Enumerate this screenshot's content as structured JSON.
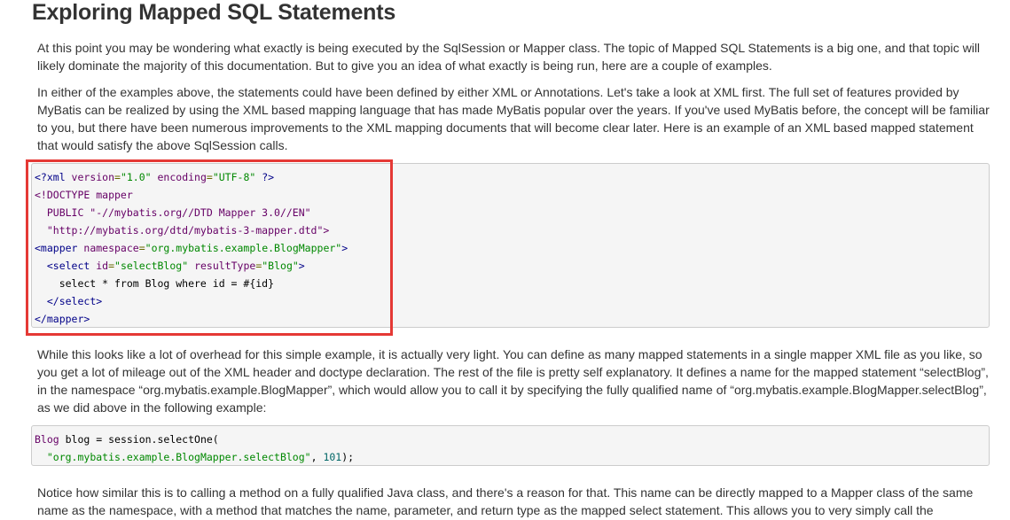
{
  "title": "Exploring Mapped SQL Statements",
  "paragraphs": {
    "p1": "At this point you may be wondering what exactly is being executed by the SqlSession or Mapper class. The topic of Mapped SQL Statements is a big one, and that topic will likely dominate the majority of this documentation. But to give you an idea of what exactly is being run, here are a couple of examples.",
    "p2": "In either of the examples above, the statements could have been defined by either XML or Annotations. Let's take a look at XML first. The full set of features provided by MyBatis can be realized by using the XML based mapping language that has made MyBatis popular over the years. If you've used MyBatis before, the concept will be familiar to you, but there have been numerous improvements to the XML mapping documents that will become clear later. Here is an example of an XML based mapped statement that would satisfy the above SqlSession calls.",
    "p3": "While this looks like a lot of overhead for this simple example, it is actually very light. You can define as many mapped statements in a single mapper XML file as you like, so you get a lot of mileage out of the XML header and doctype declaration. The rest of the file is pretty self explanatory. It defines a name for the mapped statement “selectBlog”, in the namespace “org.mybatis.example.BlogMapper”, which would allow you to call it by specifying the fully qualified name of “org.mybatis.example.BlogMapper.selectBlog”, as we did above in the following example:",
    "p4": "Notice how similar this is to calling a method on a fully qualified Java class, and there's a reason for that. This name can be directly mapped to a Mapper class of the same name as the namespace, with a method that matches the name, parameter, and return type as the mapped select statement. This allows you to very simply call the"
  },
  "code_xml": {
    "l1_open": "<?xml",
    "l1_attr1": " version",
    "l1_val1": "\"1.0\"",
    "l1_attr2": " encoding",
    "l1_val2": "\"UTF-8\"",
    "l1_close": " ?>",
    "l2": "<!DOCTYPE mapper",
    "l3": "  PUBLIC \"-//mybatis.org//DTD Mapper 3.0//EN\"",
    "l4": "  \"http://mybatis.org/dtd/mybatis-3-mapper.dtd\">",
    "l5_tag": "<mapper",
    "l5_attr": " namespace",
    "l5_val": "\"org.mybatis.example.BlogMapper\"",
    "l5_close": ">",
    "l6_indent": "  ",
    "l6_tag": "<select",
    "l6_attr1": " id",
    "l6_val1": "\"selectBlog\"",
    "l6_attr2": " resultType",
    "l6_val2": "\"Blog\"",
    "l6_close": ">",
    "l7": "    select * from Blog where id = #{id}",
    "l8_indent": "  ",
    "l8_tag": "</select>",
    "l9_tag": "</mapper>"
  },
  "code_java": {
    "l1_type": "Blog",
    "l1_rest": " blog = session.selectOne(",
    "l2_indent": "  ",
    "l2_str": "\"org.mybatis.example.BlogMapper.selectBlog\"",
    "l2_sep": ", ",
    "l2_lit": "101",
    "l2_end": ");"
  },
  "colors": {
    "highlight_border": "#e53935",
    "code_background": "#f5f5f5",
    "text": "#333333"
  }
}
